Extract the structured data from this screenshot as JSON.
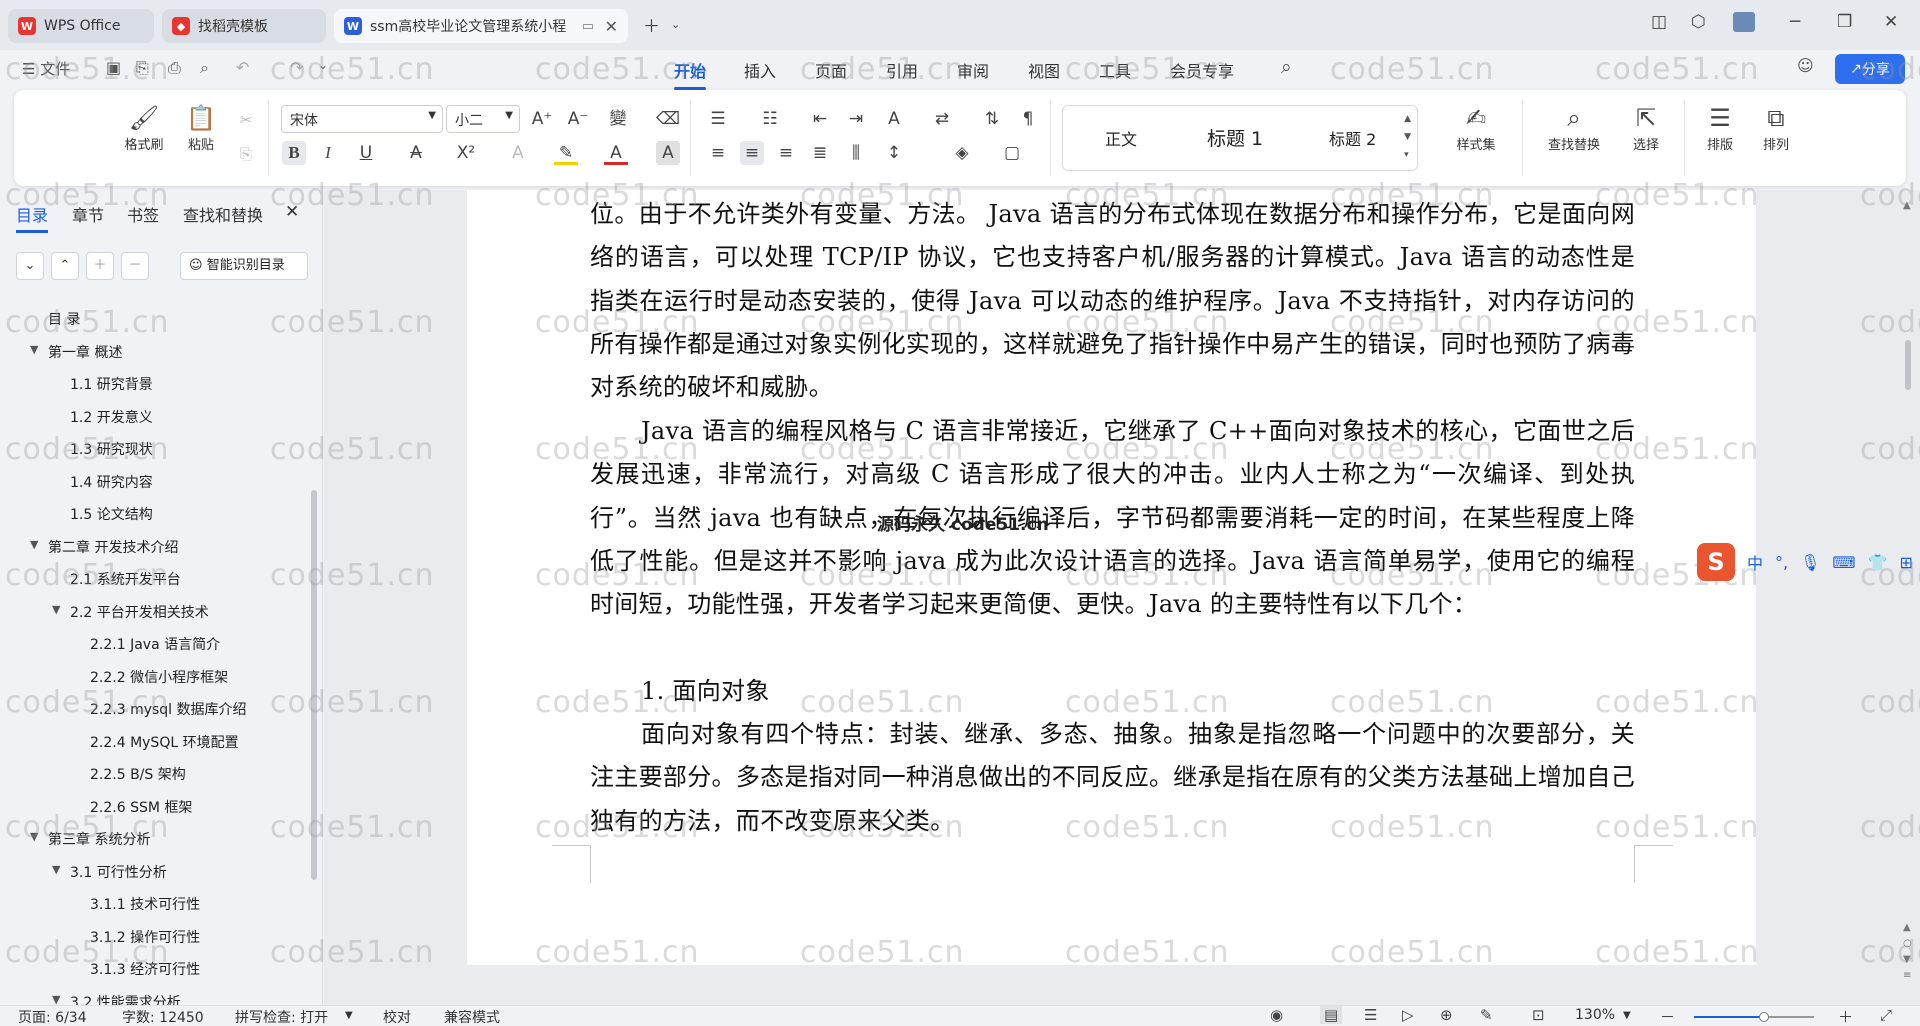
{
  "tabs": [
    {
      "label": "WPS Office",
      "icon": "wps-logo-icon",
      "color": "#e8352f"
    },
    {
      "label": "找稻壳模板",
      "icon": "docer-icon",
      "color": "#e8352f"
    },
    {
      "label": "ssm高校毕业论文管理系统小程",
      "icon": "word-doc-icon",
      "color": "#2b5fd9"
    }
  ],
  "menu": {
    "file": "文件",
    "items": [
      "开始",
      "插入",
      "页面",
      "引用",
      "审阅",
      "视图",
      "工具",
      "会员专享"
    ],
    "share": "分享"
  },
  "ribbon": {
    "format_painter": "格式刷",
    "paste": "粘贴",
    "font_name": "宋体",
    "font_size": "小二",
    "styles": [
      "正文",
      "标题 1",
      "标题 2"
    ],
    "style_set": "样式集",
    "find_replace": "查找替换",
    "select": "选择",
    "layout": "排版",
    "arrange": "排列"
  },
  "sidebar": {
    "tabs": [
      "目录",
      "章节",
      "书签",
      "查找和替换"
    ],
    "smart_toc": "智能识别目录",
    "toc": [
      {
        "text": "目 录",
        "level": 0,
        "arrow": ""
      },
      {
        "text": "第一章 概述",
        "level": 0,
        "arrow": "▼"
      },
      {
        "text": "1.1 研究背景",
        "level": 1,
        "arrow": ""
      },
      {
        "text": "1.2 开发意义",
        "level": 1,
        "arrow": ""
      },
      {
        "text": "1.3 研究现状",
        "level": 1,
        "arrow": ""
      },
      {
        "text": "1.4 研究内容",
        "level": 1,
        "arrow": ""
      },
      {
        "text": "1.5 论文结构",
        "level": 1,
        "arrow": ""
      },
      {
        "text": "第二章 开发技术介绍",
        "level": 0,
        "arrow": "▼"
      },
      {
        "text": "2.1 系统开发平台",
        "level": 1,
        "arrow": ""
      },
      {
        "text": "2.2 平台开发相关技术",
        "level": 1,
        "arrow": "▼"
      },
      {
        "text": "2.2.1 Java 语言简介",
        "level": 2,
        "arrow": ""
      },
      {
        "text": "2.2.2 微信小程序框架",
        "level": 2,
        "arrow": ""
      },
      {
        "text": "2.2.3 mysql 数据库介绍",
        "level": 2,
        "arrow": ""
      },
      {
        "text": "2.2.4 MySQL 环境配置",
        "level": 2,
        "arrow": ""
      },
      {
        "text": "2.2.5 B/S 架构",
        "level": 2,
        "arrow": ""
      },
      {
        "text": "2.2.6 SSM 框架",
        "level": 2,
        "arrow": ""
      },
      {
        "text": "第三章 系统分析",
        "level": 0,
        "arrow": "▼"
      },
      {
        "text": "3.1 可行性分析",
        "level": 1,
        "arrow": "▼"
      },
      {
        "text": "3.1.1 技术可行性",
        "level": 2,
        "arrow": ""
      },
      {
        "text": "3.1.2 操作可行性",
        "level": 2,
        "arrow": ""
      },
      {
        "text": "3.1.3 经济可行性",
        "level": 2,
        "arrow": ""
      },
      {
        "text": "3.2 性能需求分析",
        "level": 1,
        "arrow": "▼"
      }
    ]
  },
  "document": {
    "paragraphs": [
      "位。由于不允许类外有变量、方法。 Java 语言的分布式体现在数据分布和操作分布，它是面向网络的语言，可以处理 TCP/IP 协议，它也支持客户机/服务器的计算模式。Java 语言的动态性是指类在运行时是动态安装的，使得 Java 可以动态的维护程序。Java 不支持指针，对内存访问的所有操作都是通过对象实例化实现的，这样就避免了指针操作中易产生的错误，同时也预防了病毒对系统的破坏和威胁。",
      "Java 语言的编程风格与 C 语言非常接近，它继承了 C++面向对象技术的核心，它面世之后发展迅速，非常流行，对高级 C 语言形成了很大的冲击。业内人士称之为“一次编译、到处执行”。当然 java 也有缺点，在每次执行编译后，字节码都需要消耗一定的时间，在某些程度上降低了性能。但是这并不影响 java 成为此次设计语言的选择。Java 语言简单易学，使用它的编程时间短，功能性强，开发者学习起来更简便、更快。Java 的主要特性有以下几个：",
      "1. 面向对象",
      "面向对象有四个特点：封装、继承、多态、抽象。抽象是指忽略一个问题中的次要部分，关注主要部分。多态是指对同一种消息做出的不同反应。继承是指在原有的父类方法基础上增加自己独有的方法，而不改变原来父类。"
    ],
    "overlay_stamp": "源码永久 code51.cn",
    "watermark": "code51.cn"
  },
  "ime": {
    "mode": "中",
    "punct": "°,"
  },
  "status": {
    "page": "页面: 6/34",
    "words": "字数: 12450",
    "spell": "拼写检查: 打开",
    "proof": "校对",
    "compat": "兼容模式",
    "zoom": "130%"
  }
}
